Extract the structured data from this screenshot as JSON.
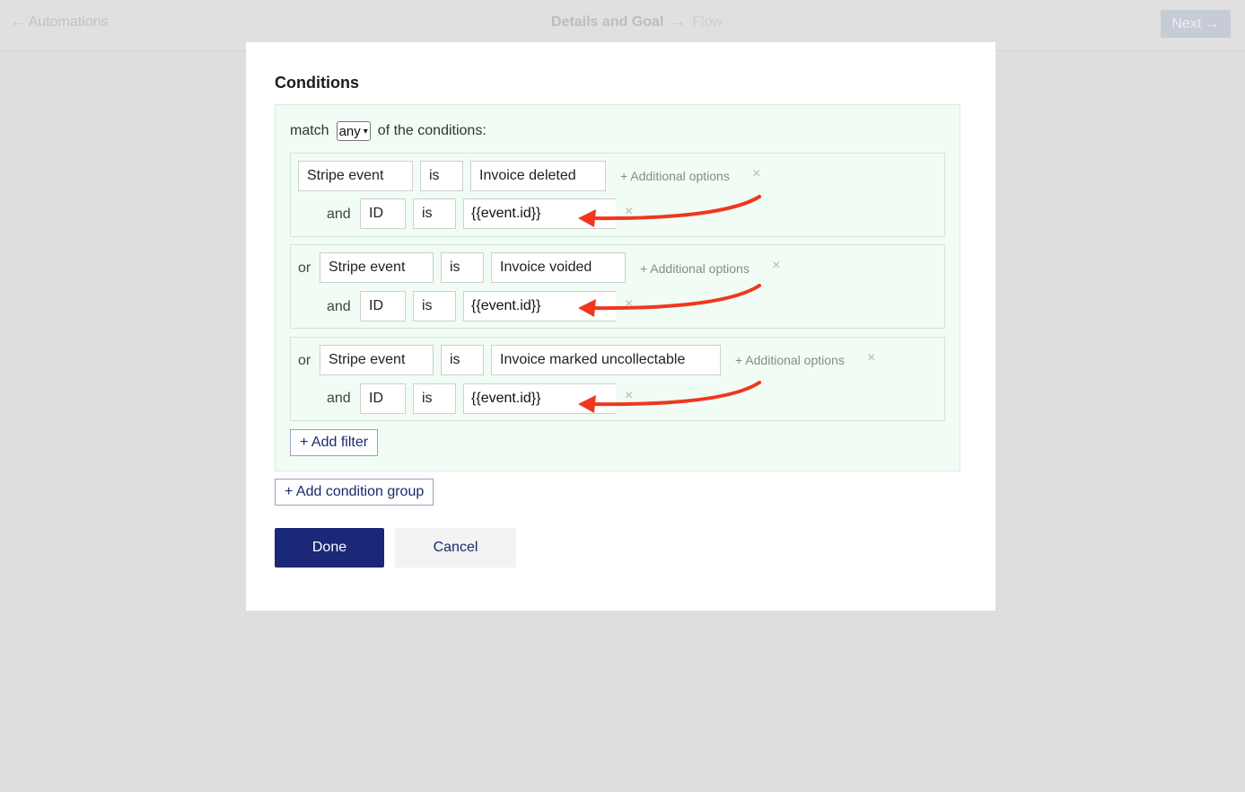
{
  "header": {
    "back_label": "← Automations",
    "step_current": "Details and Goal",
    "step_separator": "→",
    "step_next": "Flow",
    "next_button": "Next →"
  },
  "modal": {
    "title": "Conditions",
    "match_prefix": "match",
    "match_value": "any",
    "match_suffix": "of the conditions:",
    "conditions": [
      {
        "conjunction": "",
        "field": "Stripe event",
        "operator": "is",
        "value": "Invoice deleted",
        "additional_options": "+ Additional options",
        "sub_conjunction": "and",
        "sub_field": "ID",
        "sub_operator": "is",
        "sub_value": "{{event.id}}"
      },
      {
        "conjunction": "or",
        "field": "Stripe event",
        "operator": "is",
        "value": "Invoice voided",
        "additional_options": "+ Additional options",
        "sub_conjunction": "and",
        "sub_field": "ID",
        "sub_operator": "is",
        "sub_value": "{{event.id}}"
      },
      {
        "conjunction": "or",
        "field": "Stripe event",
        "operator": "is",
        "value": "Invoice marked uncollectable",
        "additional_options": "+ Additional options",
        "sub_conjunction": "and",
        "sub_field": "ID",
        "sub_operator": "is",
        "sub_value": "{{event.id}}"
      }
    ],
    "remove_glyph": "×",
    "add_filter": "+ Add filter",
    "add_condition_group": "+ Add condition group",
    "done": "Done",
    "cancel": "Cancel"
  },
  "colors": {
    "annotation_arrow": "#f0371e",
    "primary": "#1a2877",
    "group_background": "#f0fcf4"
  }
}
